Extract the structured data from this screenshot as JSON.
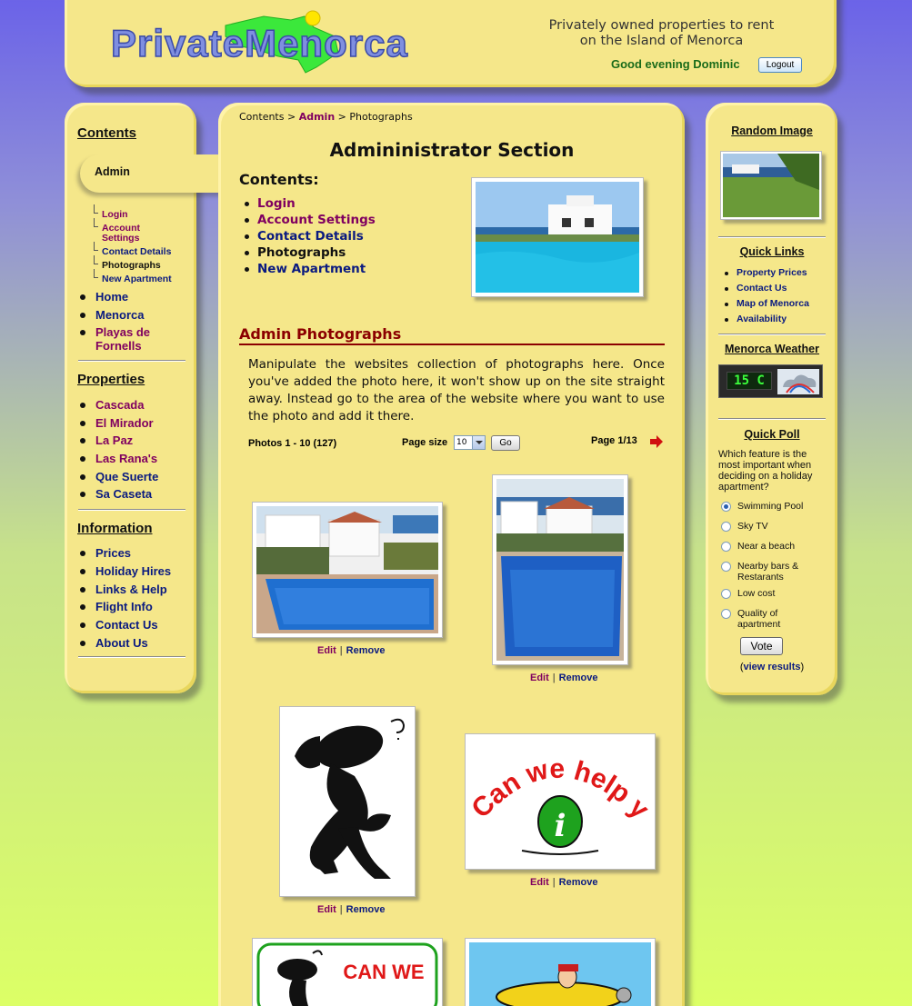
{
  "header": {
    "logo_text": "PrivateMenorca",
    "tagline_line1": "Privately owned properties to rent",
    "tagline_line2": "on the Island of Menorca",
    "greeting": "Good evening Dominic",
    "logout_label": "Logout"
  },
  "left_nav": {
    "contents_title": "Contents",
    "admin_label": "Admin",
    "admin_sublinks": [
      {
        "label": "Login"
      },
      {
        "label": "Account Settings"
      },
      {
        "label": "Contact Details"
      },
      {
        "label": "Photographs"
      },
      {
        "label": "New Apartment"
      }
    ],
    "main_links": [
      {
        "label": "Home"
      },
      {
        "label": "Menorca"
      },
      {
        "label": "Playas de Fornells"
      }
    ],
    "properties_title": "Properties",
    "properties": [
      {
        "label": "Cascada"
      },
      {
        "label": "El Mirador"
      },
      {
        "label": "La Paz"
      },
      {
        "label": "Las Rana's"
      },
      {
        "label": "Que Suerte"
      },
      {
        "label": "Sa Caseta"
      }
    ],
    "information_title": "Information",
    "information": [
      {
        "label": "Prices"
      },
      {
        "label": "Holiday Hires"
      },
      {
        "label": "Links & Help"
      },
      {
        "label": "Flight Info"
      },
      {
        "label": "Contact Us"
      },
      {
        "label": "About Us"
      }
    ]
  },
  "main": {
    "breadcrumb": {
      "root": "Contents",
      "sep1": ">",
      "admin": "Admin",
      "sep2": ">",
      "current": "Photographs"
    },
    "title": "Admininistrator Section",
    "contents_heading": "Contents:",
    "contents_links": [
      {
        "label": "Login"
      },
      {
        "label": "Account Settings"
      },
      {
        "label": "Contact Details"
      },
      {
        "label": "Photographs"
      },
      {
        "label": "New Apartment"
      }
    ],
    "section_heading": "Admin Photographs",
    "intro": "Manipulate the websites collection of photographs here. Once you've added the photo here, it won't show up on the site straight away. Instead go to the area of the website where you want to use the photo and add it there.",
    "photos_count": "Photos 1 - 10 (127)",
    "page_size_label": "Page size",
    "page_size_value": "10",
    "go_label": "Go",
    "page_label": "Page 1/13",
    "photo_actions": {
      "edit": "Edit",
      "sep": "|",
      "remove": "Remove"
    },
    "cartoon_sign_text": "Can we help you!",
    "sign2_text": "CAN WE"
  },
  "right_sidebar": {
    "random_image_title": "Random Image",
    "quick_links_title": "Quick Links",
    "quick_links": [
      {
        "label": "Property Prices"
      },
      {
        "label": "Contact Us"
      },
      {
        "label": "Map of Menorca"
      },
      {
        "label": "Availability"
      }
    ],
    "weather_title": "Menorca Weather",
    "weather_temp": "15 C",
    "poll_title": "Quick Poll",
    "poll_question": "Which feature is the most important when deciding on a holiday apartment?",
    "poll_options": [
      {
        "label": "Swimming Pool",
        "selected": true
      },
      {
        "label": "Sky TV",
        "selected": false
      },
      {
        "label": "Near a beach",
        "selected": false
      },
      {
        "label": "Nearby bars & Restarants",
        "selected": false
      },
      {
        "label": "Low cost",
        "selected": false
      },
      {
        "label": "Quality of apartment",
        "selected": false
      }
    ],
    "vote_label": "Vote",
    "view_results_prefix": "(",
    "view_results_label": "view results",
    "view_results_suffix": ")"
  },
  "colors": {
    "panel": "#f5e78a",
    "link_navy": "#0a1a80",
    "link_purple": "#800060",
    "heading_red": "#8b0000",
    "greeting_green": "#1a6b1a"
  }
}
